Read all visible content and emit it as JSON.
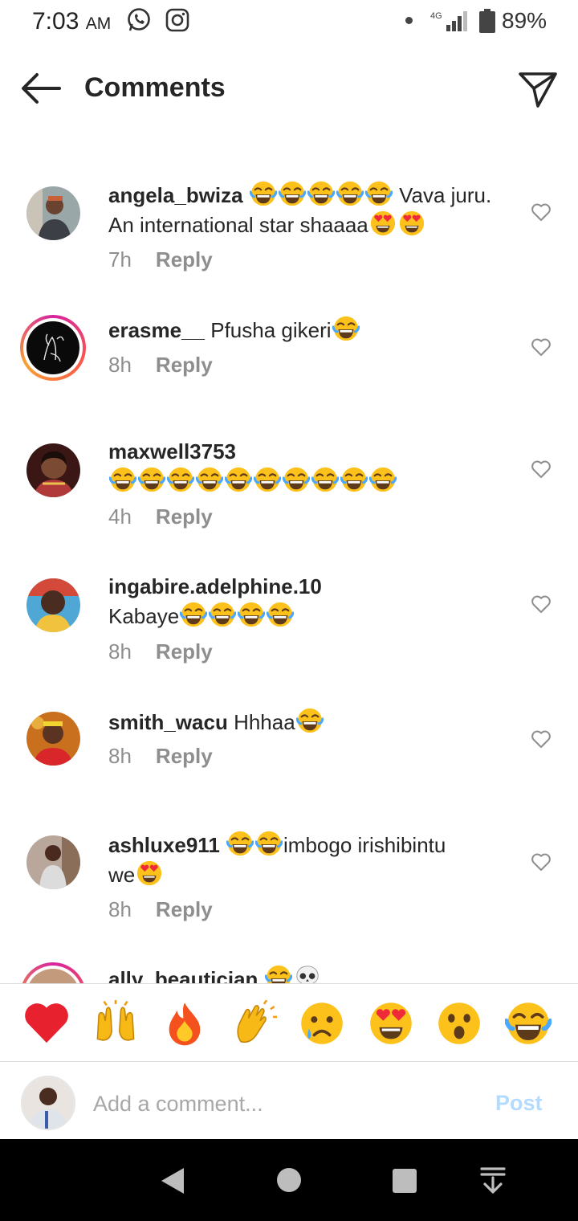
{
  "status_bar": {
    "time": "7:03",
    "ampm": "AM",
    "network": "4G",
    "battery": "89%"
  },
  "header": {
    "title": "Comments"
  },
  "comments": [
    {
      "username": "angela_bwiza",
      "text_a": "Vava juru.",
      "text_b": "An international star shaaaa",
      "time": "7h",
      "reply": "Reply",
      "emoji_a": [
        "joy",
        "joy",
        "joy",
        "joy",
        "joy"
      ],
      "emoji_b": [
        "heart-eyes",
        "heart-eyes"
      ]
    },
    {
      "username": "erasme__",
      "text": "Pfusha gikeri",
      "time": "8h",
      "reply": "Reply",
      "emoji": [
        "joy"
      ]
    },
    {
      "username": "maxwell3753",
      "time": "4h",
      "reply": "Reply",
      "emoji": [
        "joy",
        "joy",
        "joy",
        "joy",
        "joy",
        "joy",
        "joy",
        "joy",
        "joy",
        "joy"
      ]
    },
    {
      "username": "ingabire.adelphine.10",
      "text": "Kabaye",
      "time": "8h",
      "reply": "Reply",
      "emoji": [
        "joy",
        "joy",
        "joy",
        "joy"
      ]
    },
    {
      "username": "smith_wacu",
      "text": "Hhhaa",
      "time": "8h",
      "reply": "Reply",
      "emoji": [
        "joy"
      ]
    },
    {
      "username": "ashluxe911",
      "text_a": "imbogo irishibintu",
      "text_b": "we",
      "time": "8h",
      "reply": "Reply",
      "emoji_a": [
        "joy",
        "joy"
      ],
      "emoji_b": [
        "heart-eyes"
      ]
    },
    {
      "username": "ally_beautician",
      "emoji": [
        "joy",
        "skull"
      ]
    }
  ],
  "reactions": [
    "red-heart",
    "raising-hands",
    "fire",
    "clapping-hands",
    "sad-face",
    "heart-eyes",
    "surprised-face",
    "joy"
  ],
  "composer": {
    "placeholder": "Add a comment...",
    "post_label": "Post"
  },
  "colors": {
    "text": "#262626",
    "secondary": "#8e8e8e",
    "post_disabled": "#b3dbff",
    "nav_bg": "#000000"
  }
}
